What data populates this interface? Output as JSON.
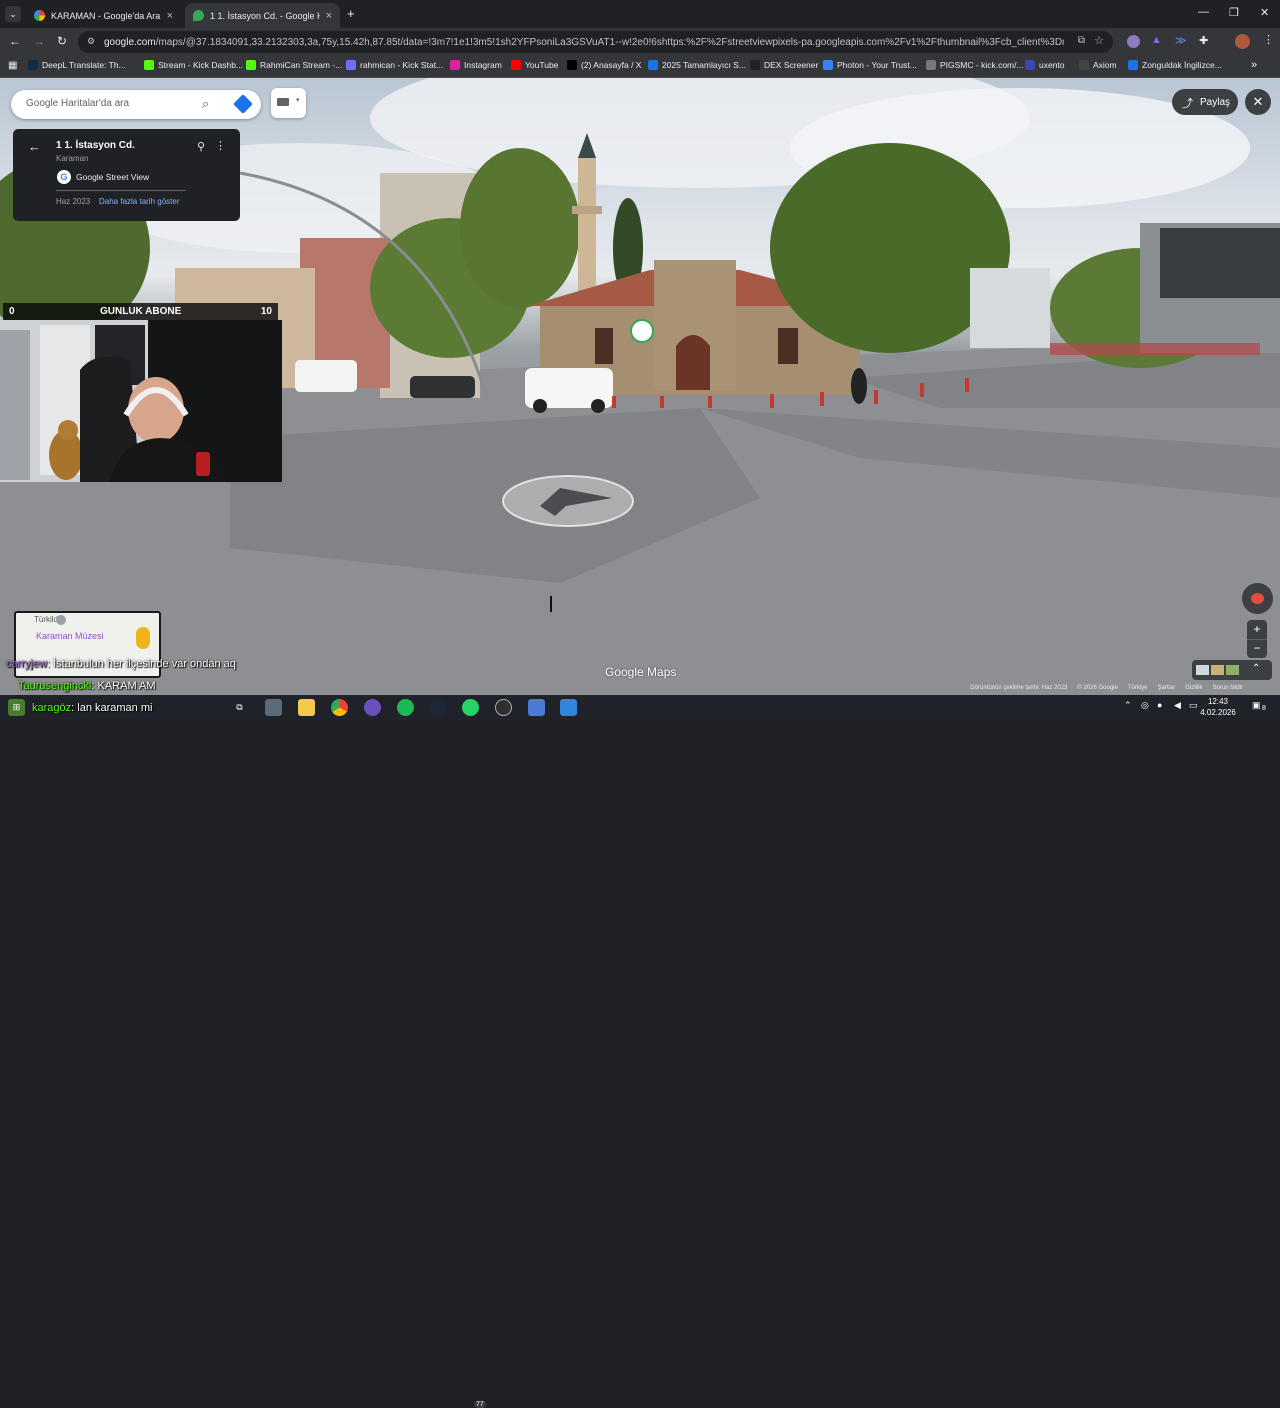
{
  "browser": {
    "tabs": [
      {
        "title": "KARAMAN - Google'da Ara",
        "active": false,
        "close": "×"
      },
      {
        "title": "1 1. İstasyon Cd. - Google Harit",
        "active": true,
        "close": "×"
      }
    ],
    "new_tab": "+",
    "url_host": "google.com",
    "url_path": "/maps/@37.1834091,33.2132303,3a,75y,15.42h,87.85t/data=!3m7!1e1!3m5!1sh2YFPsoniLa3GSVuAT1--w!2e0!6shttps:%2F%2Fstreetviewpixels-pa.googleapis.com%2Fv1%2Fthumbnail%3Fcb_client%3Dmaps_sv.tactile%26w...",
    "bookmarks": [
      {
        "label": "DeepL Translate: Th...",
        "icon": "deepl-icon",
        "color": "#0f2b46"
      },
      {
        "label": "Stream - Kick Dashb...",
        "icon": "kick-icon",
        "color": "#53fc18"
      },
      {
        "label": "RahmiCan Stream -...",
        "icon": "kick-icon",
        "color": "#53fc18"
      },
      {
        "label": "rahmican - Kick Stat...",
        "icon": "kickstat-icon",
        "color": "#6f6fff"
      },
      {
        "label": "Instagram",
        "icon": "instagram-icon",
        "color": "#d6249f"
      },
      {
        "label": "YouTube",
        "icon": "youtube-icon",
        "color": "#ff0000"
      },
      {
        "label": "(2) Anasayfa / X",
        "icon": "x-icon",
        "color": "#000000"
      },
      {
        "label": "2025 Tamamlayıcı S...",
        "icon": "globe-icon",
        "color": "#1a73e8"
      },
      {
        "label": "DEX Screener",
        "icon": "dex-icon",
        "color": "#222222"
      },
      {
        "label": "Photon - Your Trust...",
        "icon": "photon-icon",
        "color": "#3b82f6"
      },
      {
        "label": "PIGSMC - kick.com/...",
        "icon": "globe-icon",
        "color": "#777777"
      },
      {
        "label": "uxento",
        "icon": "uxento-icon",
        "color": "#3949ab"
      },
      {
        "label": "Axiom",
        "icon": "axiom-icon",
        "color": "#444444"
      },
      {
        "label": "Zonguldak İngilizce...",
        "icon": "globe-icon",
        "color": "#1a73e8"
      }
    ],
    "more_bookmarks": "»"
  },
  "maps": {
    "search_placeholder": "Google Haritalar'da ara",
    "place_title": "1 1. İstasyon Cd.",
    "place_subtitle": "Karaman",
    "source": "Google Street View",
    "capture_date": "Haz 2023",
    "more_dates": "Daha fazla tarih göster",
    "share_label": "Paylaş",
    "close_symbol": "✕",
    "zoom_in": "+",
    "zoom_out": "−",
    "watermark": "Google Maps",
    "footer": [
      "Görüntünün çekilme tarihi: Haz 2023",
      "© 2026 Google",
      "Türkiye",
      "Şartlar",
      "Gizlilik",
      "Sorun bildir"
    ],
    "minimap_label_1": "Türkildi",
    "minimap_label_2": "Karaman Müzesi"
  },
  "stream": {
    "sub_goal_left": "0",
    "sub_goal_title": "GUNLUK ABONE",
    "sub_goal_right": "10",
    "chat": [
      {
        "user": "carryjew",
        "message": ": İstanbulun her ilçesinde var ondan aq",
        "color": "#7e57c2"
      },
      {
        "user": "Taurusenginckl",
        "message": ": KARAM AM",
        "color": "#53fc18"
      },
      {
        "user": "karagöz",
        "message": ": lan karaman mi",
        "color": "#53fc18"
      }
    ]
  },
  "taskbar": {
    "time": "12:43",
    "date": "4.02.2026",
    "whatsapp_badge": "77",
    "notification_count": "8"
  }
}
